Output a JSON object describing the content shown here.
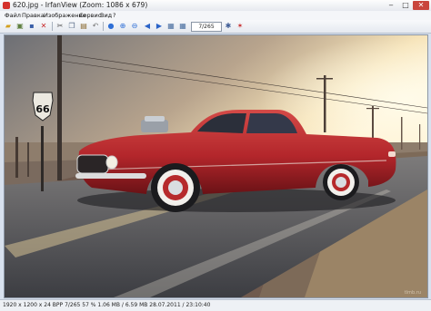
{
  "window": {
    "title": "620.jpg - IrfanView (Zoom: 1086 x 679)"
  },
  "menu": {
    "items": [
      {
        "label": "Файл"
      },
      {
        "label": "Правка"
      },
      {
        "label": "Изображение"
      },
      {
        "label": "Сервис"
      },
      {
        "label": "Вид"
      },
      {
        "label": "?"
      }
    ]
  },
  "toolbar": {
    "page_counter": "7/265"
  },
  "image": {
    "sign_text": "66",
    "watermark": "tlmb.ru"
  },
  "status": {
    "text": "1920 x 1200 x 24 BPP    7/265    57 %    1.06 MB / 6.59 MB  28.07.2011 / 23:10:40"
  },
  "colors": {
    "car_body": "#b3262b",
    "sky_glow": "#f6e3b8",
    "road": "#4e4f55",
    "close_button": "#c9463d"
  }
}
